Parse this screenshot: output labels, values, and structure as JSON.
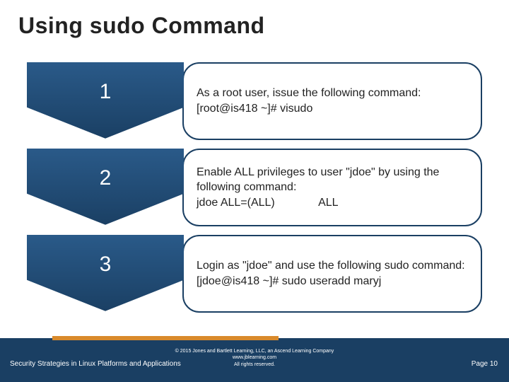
{
  "title": "Using sudo Command",
  "steps": [
    {
      "num": "1",
      "lines": [
        "As a root user, issue the following command:",
        "[root@is418 ~]# visudo"
      ]
    },
    {
      "num": "2",
      "lines": [
        "Enable ALL privileges to user \"jdoe\" by using the following command:",
        "jdoe ALL=(ALL)              ALL"
      ]
    },
    {
      "num": "3",
      "lines": [
        "Login as \"jdoe\" and use the following sudo command:",
        "[jdoe@is418 ~]# sudo useradd maryj"
      ]
    }
  ],
  "footer": {
    "left": "Security Strategies in Linux Platforms and Applications",
    "center_lines": [
      "© 2015 Jones and Bartlett Learning, LLC, an Ascend Learning Company",
      "www.jblearning.com",
      "All rights reserved."
    ],
    "right": "Page 10"
  }
}
